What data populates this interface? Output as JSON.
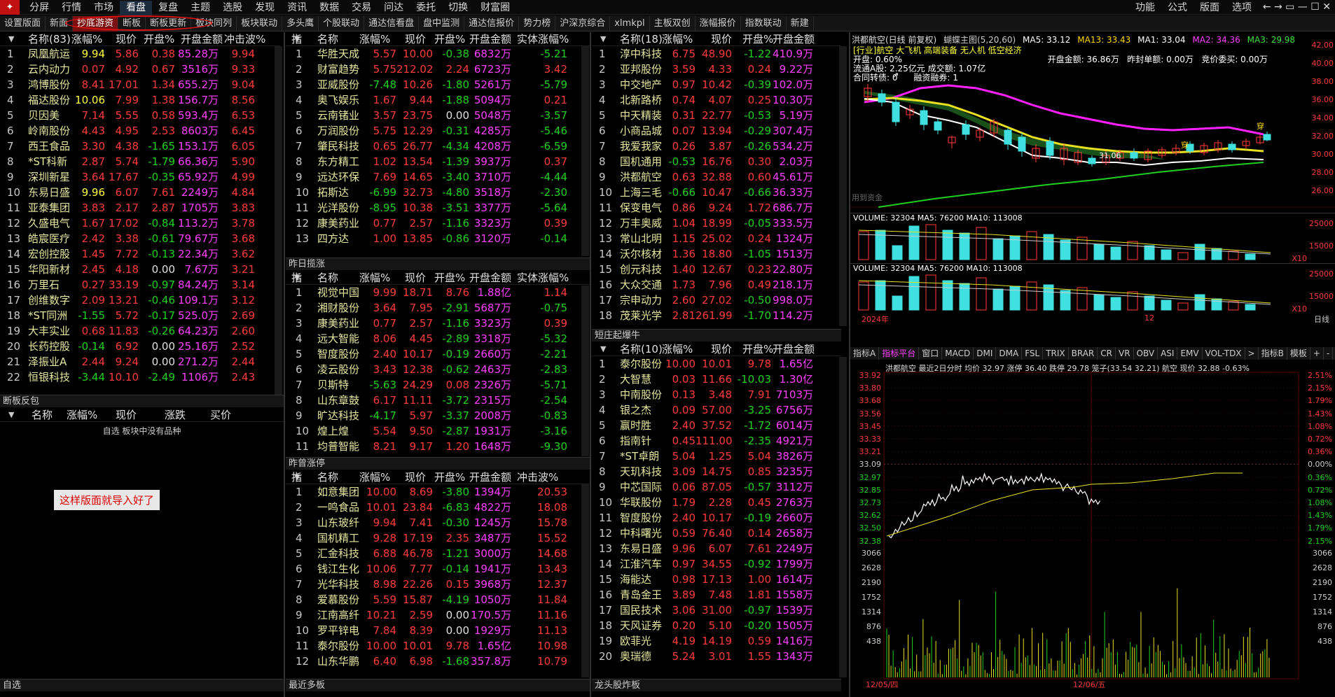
{
  "menu": {
    "logo": "通达信",
    "items": [
      "分屏",
      "行情",
      "市场",
      "看盘",
      "复盘",
      "主题",
      "选股",
      "发现",
      "资讯",
      "数据",
      "交易",
      "问达",
      "委托",
      "切换",
      "财富圈"
    ],
    "right": [
      "功能",
      "公式",
      "版面",
      "选项"
    ],
    "active": "看盘"
  },
  "tabs": [
    "设置版面",
    "新面",
    "抄底游资",
    "断板",
    "断板更新",
    "板块同列",
    "板块联动",
    "多头鹰",
    "个股联动",
    "通达信看盘",
    "盘中监测",
    "通达信报价",
    "势力榜",
    "沪深京综合",
    "xlmkpl",
    "主板双创",
    "涨幅报价",
    "指数联动",
    "新建"
  ],
  "activeTab": "抄底游资",
  "annotation": "这样版面就导入好了",
  "colors": {
    "up": "#ff3b3b",
    "down": "#20d020",
    "bg": "#000000",
    "name": "#e6e6a0"
  },
  "p1": {
    "headers": [
      "名称(83)",
      "涨幅%",
      "现价",
      "开盘%",
      "开盘金额",
      "冲击波%"
    ],
    "rows": [
      [
        "1",
        "凤凰航运",
        "9.94",
        "5.86",
        "0.38",
        "85.28万",
        "9.94"
      ],
      [
        "2",
        "云内动力",
        "0.07",
        "4.92",
        "0.67",
        "3516万",
        "9.33"
      ],
      [
        "3",
        "鸿博股份",
        "8.41",
        "17.01",
        "1.34",
        "655.2万",
        "9.04"
      ],
      [
        "4",
        "福达股份",
        "10.06",
        "7.99",
        "1.38",
        "156.7万",
        "8.56"
      ],
      [
        "5",
        "贝因美",
        "7.14",
        "5.55",
        "0.58",
        "593.4万",
        "6.53"
      ],
      [
        "6",
        "岭南股份",
        "4.43",
        "4.95",
        "2.53",
        "8603万",
        "6.45"
      ],
      [
        "7",
        "西王食品",
        "3.30",
        "4.38",
        "-1.65",
        "153.1万",
        "6.05"
      ],
      [
        "8",
        "*ST科新",
        "2.87",
        "5.74",
        "-1.79",
        "66.36万",
        "5.90"
      ],
      [
        "9",
        "深圳新星",
        "3.64",
        "17.67",
        "-0.35",
        "65.92万",
        "4.99"
      ],
      [
        "10",
        "东易日盛",
        "9.96",
        "6.07",
        "7.61",
        "2249万",
        "4.84"
      ],
      [
        "11",
        "亚泰集团",
        "3.83",
        "2.17",
        "2.87",
        "1705万",
        "3.83"
      ],
      [
        "12",
        "久盛电气",
        "1.67",
        "17.02",
        "-0.84",
        "113.2万",
        "3.78"
      ],
      [
        "13",
        "皓宸医疗",
        "2.42",
        "3.38",
        "-0.61",
        "79.67万",
        "3.68"
      ],
      [
        "14",
        "宏创控股",
        "1.45",
        "7.72",
        "-0.13",
        "22.34万",
        "3.62"
      ],
      [
        "15",
        "华阳新材",
        "2.45",
        "4.18",
        "0.00",
        "7.67万",
        "3.21"
      ],
      [
        "16",
        "万里石",
        "0.27",
        "33.19",
        "-0.97",
        "84.24万",
        "3.14"
      ],
      [
        "17",
        "创维数字",
        "2.09",
        "13.21",
        "-0.46",
        "109.1万",
        "3.12"
      ],
      [
        "18",
        "*ST同洲",
        "-1.55",
        "5.72",
        "-0.17",
        "525.0万",
        "2.69"
      ],
      [
        "19",
        "大丰实业",
        "0.68",
        "11.83",
        "-0.26",
        "64.23万",
        "2.60"
      ],
      [
        "20",
        "长药控股",
        "-0.14",
        "6.92",
        "0.00",
        "25.16万",
        "2.52"
      ],
      [
        "21",
        "泽振业A",
        "2.44",
        "9.24",
        "0.00",
        "271.2万",
        "2.44"
      ],
      [
        "22",
        "恒银科技",
        "-3.44",
        "10.10",
        "-2.49",
        "1106万",
        "2.43"
      ]
    ]
  },
  "p1b": {
    "title": "断板反包",
    "headers": [
      "名称",
      "涨幅%",
      "现价",
      "涨跌",
      "买价"
    ],
    "empty": "自选 板块中没有品种"
  },
  "p1c": {
    "title": "自选"
  },
  "p2": {
    "headers": [
      "指",
      "名称",
      "涨幅%",
      "现价",
      "开盘%",
      "开盘金额",
      "实体涨幅%"
    ],
    "rows": [
      [
        "1",
        "华胜天成",
        "5.57",
        "10.00",
        "-0.38",
        "6832万",
        "-5.21"
      ],
      [
        "2",
        "财富趋势",
        "5.75",
        "212.02",
        "2.24",
        "6723万",
        "3.42"
      ],
      [
        "3",
        "亚威股份",
        "-7.48",
        "10.26",
        "-1.80",
        "5261万",
        "-5.79"
      ],
      [
        "4",
        "奥飞娱乐",
        "1.67",
        "9.44",
        "-1.88",
        "5094万",
        "0.21"
      ],
      [
        "5",
        "云南锗业",
        "3.57",
        "23.75",
        "0.00",
        "5048万",
        "-3.57"
      ],
      [
        "6",
        "万润股份",
        "5.75",
        "12.29",
        "-0.31",
        "4285万",
        "-5.46"
      ],
      [
        "7",
        "肇民科技",
        "0.65",
        "26.77",
        "-4.34",
        "4208万",
        "-6.59"
      ],
      [
        "8",
        "东方精工",
        "1.02",
        "13.54",
        "-1.39",
        "3937万",
        "0.37"
      ],
      [
        "9",
        "远达环保",
        "7.69",
        "14.65",
        "-3.40",
        "3710万",
        "-4.44"
      ],
      [
        "10",
        "拓斯达",
        "-6.99",
        "32.73",
        "-4.80",
        "3518万",
        "-2.30"
      ],
      [
        "11",
        "光洋股份",
        "-8.95",
        "10.38",
        "-3.51",
        "3377万",
        "-5.64"
      ],
      [
        "12",
        "康美药业",
        "0.77",
        "2.57",
        "-1.16",
        "3323万",
        "0.39"
      ],
      [
        "13",
        "四方达",
        "1.00",
        "13.85",
        "-0.86",
        "3120万",
        "-0.14"
      ]
    ]
  },
  "p2b": {
    "title": "昨日揽涨",
    "headers": [
      "指",
      "名称",
      "涨幅%",
      "现价",
      "开盘%",
      "开盘金额",
      "实体涨幅%"
    ],
    "rows": [
      [
        "1",
        "视觉中国",
        "9.99",
        "18.71",
        "8.76",
        "1.88亿",
        "1.14"
      ],
      [
        "2",
        "湘财股份",
        "3.64",
        "7.95",
        "-2.91",
        "5687万",
        "-0.75"
      ],
      [
        "3",
        "康美药业",
        "0.77",
        "2.57",
        "-1.16",
        "3323万",
        "0.39"
      ],
      [
        "4",
        "远大智能",
        "8.06",
        "4.45",
        "-2.89",
        "3318万",
        "-5.32"
      ],
      [
        "5",
        "智度股份",
        "2.40",
        "10.17",
        "-0.19",
        "2660万",
        "-2.21"
      ],
      [
        "6",
        "凌云股份",
        "3.43",
        "12.38",
        "-0.62",
        "2463万",
        "-2.83"
      ],
      [
        "7",
        "贝斯特",
        "-5.63",
        "24.29",
        "0.08",
        "2326万",
        "-5.71"
      ],
      [
        "8",
        "山东章鼓",
        "6.17",
        "11.11",
        "-3.72",
        "2315万",
        "-2.54"
      ],
      [
        "9",
        "旷达科技",
        "-4.17",
        "5.97",
        "-3.37",
        "2008万",
        "-0.83"
      ],
      [
        "10",
        "煌上煌",
        "5.54",
        "9.50",
        "-2.87",
        "1931万",
        "-3.16"
      ],
      [
        "11",
        "均普智能",
        "8.21",
        "9.17",
        "1.20",
        "1648万",
        "-9.30"
      ]
    ]
  },
  "p2c": {
    "title": "昨曾涨停",
    "headers": [
      "指",
      "名称",
      "涨幅%",
      "现价",
      "开盘%",
      "开盘金额",
      "冲击波%"
    ],
    "rows": [
      [
        "1",
        "如意集团",
        "10.00",
        "8.69",
        "-3.80",
        "1394万",
        "20.53"
      ],
      [
        "2",
        "一鸣食品",
        "10.01",
        "23.84",
        "-6.83",
        "4822万",
        "18.08"
      ],
      [
        "3",
        "山东玻纤",
        "9.94",
        "7.41",
        "-0.30",
        "1245万",
        "15.78"
      ],
      [
        "4",
        "国机精工",
        "9.28",
        "17.19",
        "2.35",
        "3487万",
        "15.52"
      ],
      [
        "5",
        "汇金科技",
        "6.88",
        "46.78",
        "-1.21",
        "3000万",
        "14.68"
      ],
      [
        "6",
        "钱江生化",
        "10.06",
        "7.77",
        "-0.14",
        "1941万",
        "13.43"
      ],
      [
        "7",
        "光华科技",
        "8.98",
        "22.26",
        "0.15",
        "3968万",
        "12.37"
      ],
      [
        "8",
        "爱慕股份",
        "5.59",
        "15.87",
        "-4.19",
        "1050万",
        "11.84"
      ],
      [
        "9",
        "江南高纤",
        "10.21",
        "2.59",
        "0.00",
        "170.5万",
        "11.16"
      ],
      [
        "10",
        "罗平锌电",
        "7.84",
        "8.39",
        "0.00",
        "1929万",
        "11.13"
      ],
      [
        "11",
        "泰尔股份",
        "10.00",
        "10.01",
        "9.78",
        "1.65亿",
        "10.98"
      ],
      [
        "12",
        "山东华鹏",
        "6.40",
        "6.98",
        "-1.68",
        "357.8万",
        "10.79"
      ]
    ]
  },
  "p2d": {
    "title": "最近多板"
  },
  "p3": {
    "headers": [
      "名称(18)",
      "涨幅%",
      "现价",
      "开盘%",
      "开盘金额"
    ],
    "rows": [
      [
        "1",
        "淳中科技",
        "6.75",
        "48.90",
        "-1.22",
        "410.9万"
      ],
      [
        "2",
        "亚邦股份",
        "3.59",
        "4.33",
        "0.24",
        "9.22万"
      ],
      [
        "3",
        "中交地产",
        "0.97",
        "10.42",
        "-0.39",
        "102.0万"
      ],
      [
        "4",
        "北新路桥",
        "0.74",
        "4.07",
        "0.25",
        "10.30万"
      ],
      [
        "5",
        "中天精装",
        "0.31",
        "22.77",
        "-0.53",
        "5.19万"
      ],
      [
        "6",
        "小商品城",
        "0.07",
        "13.94",
        "-0.29",
        "307.4万"
      ],
      [
        "7",
        "我爱我家",
        "0.26",
        "3.87",
        "-0.26",
        "534.2万"
      ],
      [
        "8",
        "国机通用",
        "-0.53",
        "16.76",
        "0.30",
        "2.03万"
      ],
      [
        "9",
        "洪都航空",
        "0.63",
        "32.88",
        "0.60",
        "45.61万"
      ],
      [
        "10",
        "上海三毛",
        "-0.66",
        "10.47",
        "-0.66",
        "36.33万"
      ],
      [
        "11",
        "保变电气",
        "0.86",
        "9.24",
        "1.72",
        "686.7万"
      ],
      [
        "12",
        "万丰奥威",
        "1.04",
        "18.99",
        "-0.05",
        "333.5万"
      ],
      [
        "13",
        "常山北明",
        "1.15",
        "25.02",
        "0.24",
        "1324万"
      ],
      [
        "14",
        "沃尔核材",
        "1.36",
        "18.80",
        "-1.05",
        "1513万"
      ],
      [
        "15",
        "创元科技",
        "1.40",
        "12.67",
        "0.23",
        "22.80万"
      ],
      [
        "16",
        "大众交通",
        "1.73",
        "7.96",
        "0.49",
        "218.1万"
      ],
      [
        "17",
        "宗申动力",
        "2.60",
        "27.02",
        "-0.50",
        "998.0万"
      ],
      [
        "18",
        "茂莱光学",
        "2.81",
        "261.99",
        "-1.70",
        "114.2万"
      ]
    ]
  },
  "p3b": {
    "title": "短庄起爆牛",
    "headers": [
      "名称(10)",
      "涨幅%",
      "现价",
      "开盘%",
      "开盘金额"
    ],
    "rows": [
      [
        "1",
        "泰尔股份",
        "10.00",
        "10.01",
        "9.78",
        "1.65亿"
      ],
      [
        "2",
        "大智慧",
        "0.03",
        "11.66",
        "-10.03",
        "1.30亿"
      ],
      [
        "3",
        "中南股份",
        "0.13",
        "3.48",
        "7.91",
        "7103万"
      ],
      [
        "4",
        "银之杰",
        "0.09",
        "57.00",
        "-3.25",
        "6756万"
      ],
      [
        "5",
        "赢时胜",
        "2.40",
        "37.52",
        "-1.72",
        "6014万"
      ],
      [
        "6",
        "指南针",
        "0.45",
        "111.00",
        "-2.35",
        "4921万"
      ],
      [
        "7",
        "*ST卓朗",
        "5.04",
        "1.25",
        "5.04",
        "3826万"
      ],
      [
        "8",
        "天玑科技",
        "3.09",
        "14.75",
        "0.85",
        "3235万"
      ],
      [
        "9",
        "中芯国际",
        "0.06",
        "87.05",
        "-0.57",
        "3112万"
      ],
      [
        "10",
        "华联股份",
        "1.79",
        "2.28",
        "0.45",
        "2763万"
      ],
      [
        "11",
        "智度股份",
        "2.40",
        "10.17",
        "-0.19",
        "2660万"
      ],
      [
        "12",
        "中科曙光",
        "0.59",
        "76.40",
        "0.14",
        "2658万"
      ],
      [
        "13",
        "东易日盛",
        "9.96",
        "6.07",
        "7.61",
        "2249万"
      ],
      [
        "14",
        "江淮汽车",
        "0.97",
        "34.55",
        "-0.92",
        "1799万"
      ],
      [
        "15",
        "海能达",
        "0.98",
        "17.13",
        "1.00",
        "1614万"
      ],
      [
        "16",
        "青岛金王",
        "3.89",
        "7.48",
        "1.81",
        "1558万"
      ],
      [
        "17",
        "国民技术",
        "3.06",
        "31.00",
        "-0.97",
        "1539万"
      ],
      [
        "18",
        "天风证券",
        "0.20",
        "5.10",
        "-0.20",
        "1505万"
      ],
      [
        "19",
        "欧菲光",
        "4.19",
        "14.19",
        "0.59",
        "1416万"
      ],
      [
        "20",
        "奥瑞德",
        "5.24",
        "3.01",
        "1.55",
        "1343万"
      ]
    ]
  },
  "p3c": {
    "title": "龙头股炸板"
  },
  "kline": {
    "title": "洪都航空(日线 前复权)",
    "mainLabel": "蝴蝶主图(5,20,60)",
    "ma5": "MA5: 33.12",
    "ma13": "MA13: 33.43",
    "ma1": "MA1: 33.04",
    "ma2": "MA2: 34.36",
    "ma3": "MA3: 29.98",
    "info1": "[行业]航空",
    "info2": "大飞机 高端装备 无人机 低空经济",
    "info3": "开盘: 0.60%",
    "info4": "流通A股: 2.25亿元",
    "info5": "成交额: 1.07亿",
    "info6": "合同转债: 0",
    "info7": "融资融券: 1",
    "info8": "开盘金额: 36.86万",
    "info9": "昨封单额: 0.00万",
    "info10": "竞价委买: 0.00万",
    "low": "31.06",
    "mark": "用到资金",
    "yticks": [
      "42.00",
      "40.00",
      "38.00",
      "36.00",
      "34.00",
      "32.00",
      "30.00",
      "28.00",
      "26.00"
    ],
    "vol1": "VOLUME: 32304  MA5: 76200  MA10: 113008",
    "vol2": "VOLUME: 32304  MA5: 76200  MA10: 113008",
    "volTicks": [
      "25000",
      "15000",
      "X10"
    ],
    "xdate1": "2024年",
    "xdate2": "12",
    "xlabel": "日线"
  },
  "btabs": [
    "指标A",
    "指标平台",
    "窗口",
    "MACD",
    "DMI",
    "DMA",
    "FSL",
    "TRIX",
    "BRAR",
    "CR",
    "VR",
    "OBV",
    "ASI",
    "EMV",
    "VOL-TDX",
    ">",
    "指标B",
    "模板",
    "+",
    "-"
  ],
  "intraday": {
    "header": "洪都航空  最近2日分时  均价 32.97  涨停 36.40  跌停 29.78  笼子(33.54 32.21)  航空  现价 32.88  -0.63%",
    "left": [
      "33.92",
      "33.80",
      "33.68",
      "33.56",
      "33.45",
      "33.33",
      "33.21",
      "33.09",
      "32.97",
      "32.85",
      "32.73",
      "32.62",
      "32.50",
      "32.38",
      "3066",
      "2628",
      "2190",
      "1752",
      "1314",
      "876",
      "438"
    ],
    "right": [
      "2.51%",
      "2.15%",
      "1.79%",
      "1.43%",
      "1.08%",
      "0.72%",
      "0.36%",
      "0.00%",
      "0.36%",
      "0.72%",
      "1.08%",
      "1.43%",
      "1.79%",
      "2.15%",
      "3066",
      "2628",
      "2190",
      "1752",
      "1314",
      "876",
      "438"
    ],
    "dates": [
      "12/05/四",
      "12/06/五"
    ]
  }
}
